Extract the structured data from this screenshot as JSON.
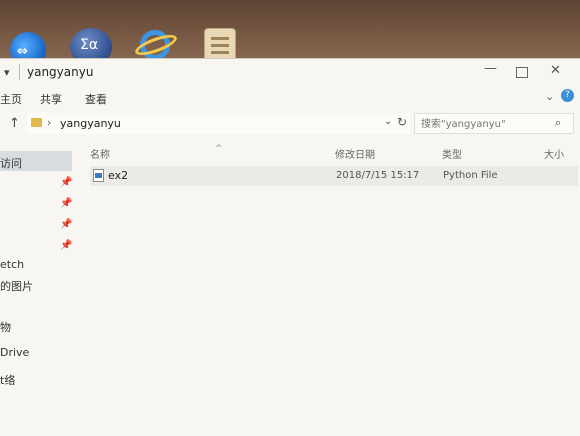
{
  "desktop": {
    "icons": [
      "teamviewer-icon",
      "math-app-icon",
      "internet-explorer-icon",
      "document-folder-icon"
    ],
    "math_icon_glyph": "Σα",
    "teamviewer_glyph": "⇔"
  },
  "window": {
    "title": "yangyanyu",
    "controls": {
      "minimize": "—",
      "maximize": "",
      "close": "✕"
    }
  },
  "ribbon": {
    "tabs": [
      "主页",
      "共享",
      "查看"
    ],
    "expand": "⌄",
    "help": "?"
  },
  "address": {
    "up": "↑",
    "chevron": "›",
    "path": "yangyanyu",
    "dropdown": "⌄",
    "refresh": "↻"
  },
  "search": {
    "placeholder": "搜索\"yangyanyu\"",
    "icon": "⌕"
  },
  "nav": {
    "items": [
      "访问",
      "etch",
      "的图片",
      "物",
      "Drive",
      "t络"
    ],
    "pin": "📌"
  },
  "columns": {
    "name": "名称",
    "modified": "修改日期",
    "type": "类型",
    "size": "大小",
    "sort": "^"
  },
  "files": [
    {
      "name": "ex2",
      "modified": "2018/7/15 15:17",
      "type": "Python File",
      "size": ""
    }
  ],
  "colors": {
    "accent": "#3b8fd8",
    "folder": "#e0b84d",
    "window_bg": "#f7f6f1"
  }
}
